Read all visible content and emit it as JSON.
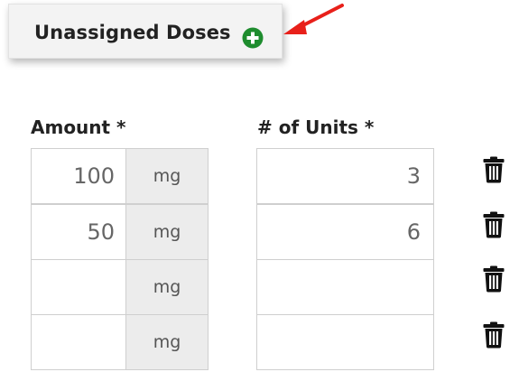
{
  "header": {
    "doses_label": "Unassigned Doses",
    "add_icon": "plus-circle-icon",
    "accent_color": "#1e8c2e",
    "annotation_arrow_color": "#e8201a"
  },
  "columns": {
    "amount_header": "Amount *",
    "units_header": "# of Units *"
  },
  "rows": [
    {
      "amount": "100",
      "unit": "mg",
      "units": "3"
    },
    {
      "amount": "50",
      "unit": "mg",
      "units": "6"
    },
    {
      "amount": "",
      "unit": "mg",
      "units": ""
    },
    {
      "amount": "",
      "unit": "mg",
      "units": ""
    }
  ],
  "row_action_icon": "trash-icon"
}
